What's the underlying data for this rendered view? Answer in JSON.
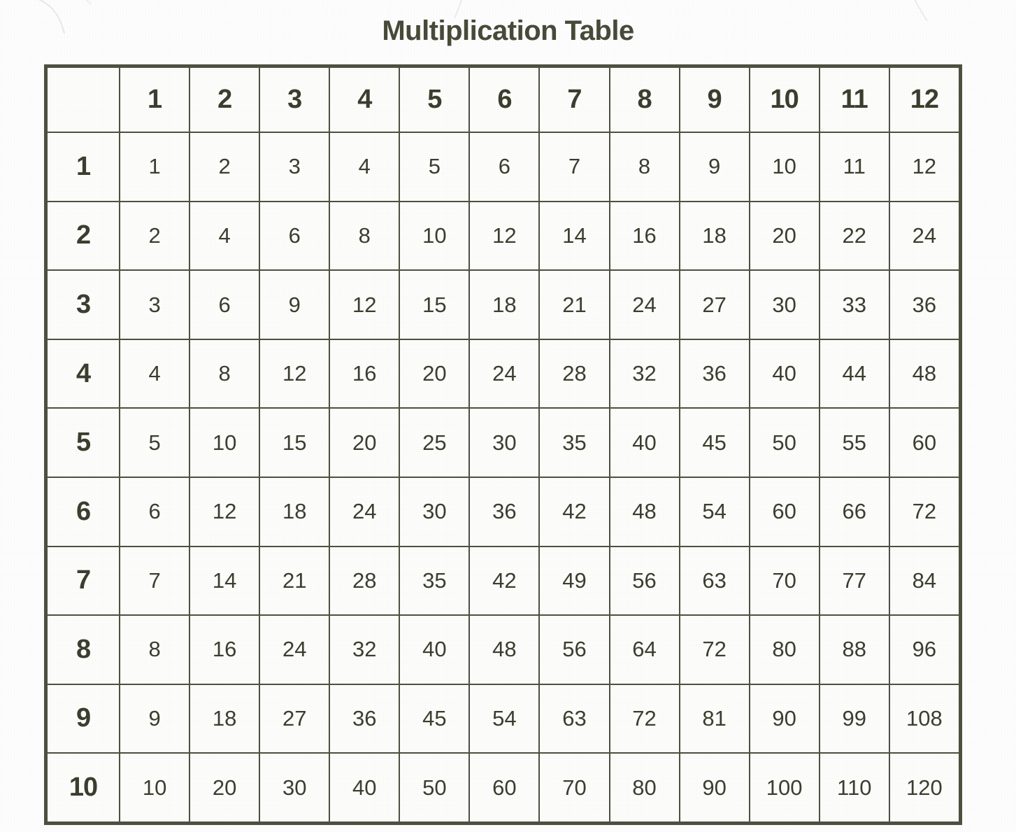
{
  "document": {
    "title": "Multiplication Table",
    "background_color": "#fefefe",
    "ink_color": "#3b3e2e",
    "grid_line_color": "#4d5040"
  },
  "chart_data": {
    "type": "table",
    "title": "Multiplication Table",
    "corner_label": "",
    "column_headers": [
      "1",
      "2",
      "3",
      "4",
      "5",
      "6",
      "7",
      "8",
      "9",
      "10",
      "11",
      "12"
    ],
    "row_headers": [
      "1",
      "2",
      "3",
      "4",
      "5",
      "6",
      "7",
      "8",
      "9",
      "10"
    ],
    "rows": [
      {
        "header": "1",
        "values": [
          "1",
          "2",
          "3",
          "4",
          "5",
          "6",
          "7",
          "8",
          "9",
          "10",
          "11",
          "12"
        ]
      },
      {
        "header": "2",
        "values": [
          "2",
          "4",
          "6",
          "8",
          "10",
          "12",
          "14",
          "16",
          "18",
          "20",
          "22",
          "24"
        ]
      },
      {
        "header": "3",
        "values": [
          "3",
          "6",
          "9",
          "12",
          "15",
          "18",
          "21",
          "24",
          "27",
          "30",
          "33",
          "36"
        ]
      },
      {
        "header": "4",
        "values": [
          "4",
          "8",
          "12",
          "16",
          "20",
          "24",
          "28",
          "32",
          "36",
          "40",
          "44",
          "48"
        ]
      },
      {
        "header": "5",
        "values": [
          "5",
          "10",
          "15",
          "20",
          "25",
          "30",
          "35",
          "40",
          "45",
          "50",
          "55",
          "60"
        ]
      },
      {
        "header": "6",
        "values": [
          "6",
          "12",
          "18",
          "24",
          "30",
          "36",
          "42",
          "48",
          "54",
          "60",
          "66",
          "72"
        ]
      },
      {
        "header": "7",
        "values": [
          "7",
          "14",
          "21",
          "28",
          "35",
          "42",
          "49",
          "56",
          "63",
          "70",
          "77",
          "84"
        ]
      },
      {
        "header": "8",
        "values": [
          "8",
          "16",
          "24",
          "32",
          "40",
          "48",
          "56",
          "64",
          "72",
          "80",
          "88",
          "96"
        ]
      },
      {
        "header": "9",
        "values": [
          "9",
          "18",
          "27",
          "36",
          "45",
          "54",
          "63",
          "72",
          "81",
          "90",
          "99",
          "108"
        ]
      },
      {
        "header": "10",
        "values": [
          "10",
          "20",
          "30",
          "40",
          "50",
          "60",
          "70",
          "80",
          "90",
          "100",
          "110",
          "120"
        ]
      }
    ]
  }
}
